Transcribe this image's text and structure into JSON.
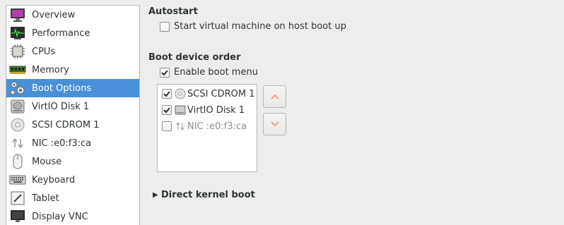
{
  "sidebar": {
    "items": [
      {
        "label": "Overview",
        "icon": "overview-icon"
      },
      {
        "label": "Performance",
        "icon": "performance-icon"
      },
      {
        "label": "CPUs",
        "icon": "cpu-icon"
      },
      {
        "label": "Memory",
        "icon": "memory-icon"
      },
      {
        "label": "Boot Options",
        "icon": "boot-options-icon",
        "selected": true
      },
      {
        "label": "VirtIO Disk 1",
        "icon": "hard-disk-icon"
      },
      {
        "label": "SCSI CDROM 1",
        "icon": "cdrom-icon"
      },
      {
        "label": "NIC :e0:f3:ca",
        "icon": "network-icon"
      },
      {
        "label": "Mouse",
        "icon": "mouse-icon"
      },
      {
        "label": "Keyboard",
        "icon": "keyboard-icon"
      },
      {
        "label": "Tablet",
        "icon": "tablet-icon"
      },
      {
        "label": "Display VNC",
        "icon": "display-icon"
      }
    ]
  },
  "autostart": {
    "title": "Autostart",
    "checkbox_label": "Start virtual machine on host boot up",
    "checked": false
  },
  "boot_order": {
    "title": "Boot device order",
    "enable_menu_label": "Enable boot menu",
    "enable_menu_checked": true,
    "devices": [
      {
        "label": "SCSI CDROM 1",
        "checked": true,
        "icon": "cdrom-icon",
        "enabled": true
      },
      {
        "label": "VirtIO Disk 1",
        "checked": true,
        "icon": "hard-disk-icon",
        "enabled": true
      },
      {
        "label": "NIC :e0:f3:ca",
        "checked": false,
        "icon": "network-icon",
        "enabled": false
      }
    ],
    "move_up_icon": "chevron-up-icon",
    "move_down_icon": "chevron-down-icon"
  },
  "direct_kernel": {
    "label": "Direct kernel boot",
    "expanded": false
  },
  "colors": {
    "selection": "#4a90d9",
    "arrow": "#f0a080",
    "background": "#ededed"
  }
}
